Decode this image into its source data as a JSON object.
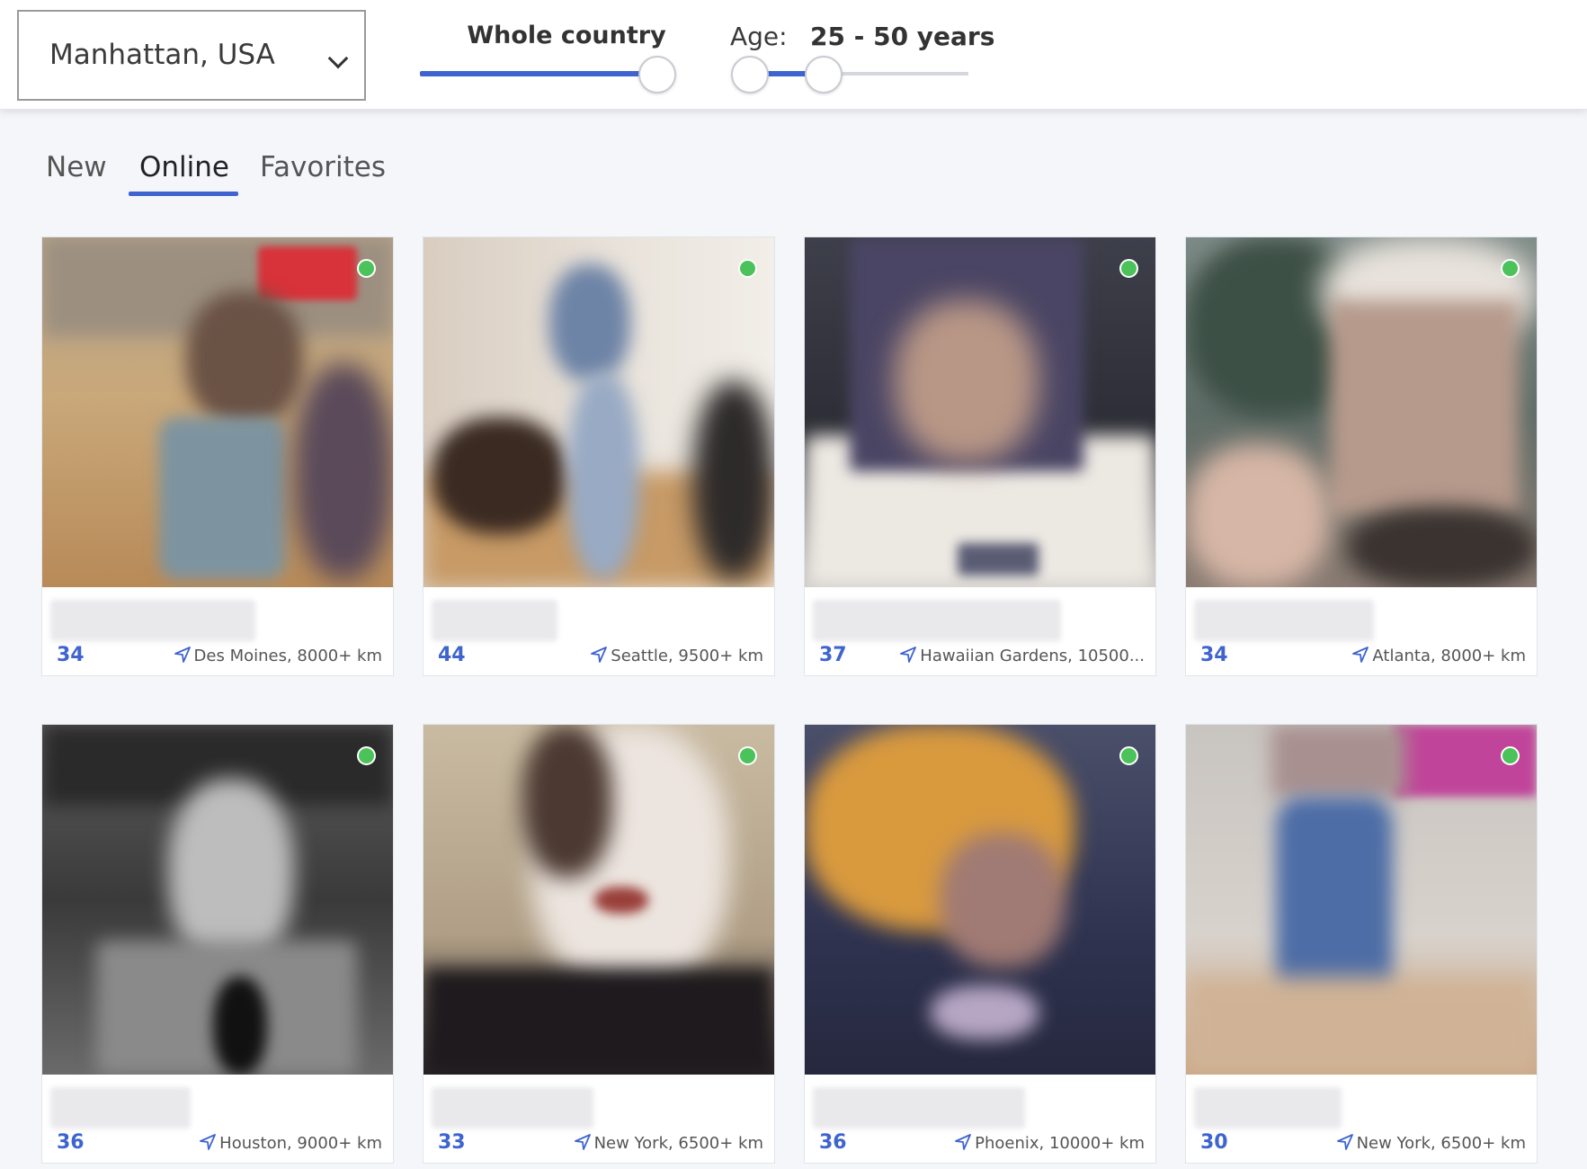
{
  "filters": {
    "location": "Manhattan, USA",
    "distance_label": "Whole country",
    "distance_value": 1.0,
    "age_label": "Age:",
    "age_range_text": "25 - 50 years",
    "age_range": [
      25,
      50
    ],
    "accent_color": "#3e64d0"
  },
  "tabs": [
    {
      "label": "New",
      "active": false
    },
    {
      "label": "Online",
      "active": true
    },
    {
      "label": "Favorites",
      "active": false
    }
  ],
  "profiles": [
    {
      "age": "34",
      "location": "Des Moines, 8000+ km",
      "online": true
    },
    {
      "age": "44",
      "location": "Seattle, 9500+ km",
      "online": true
    },
    {
      "age": "37",
      "location": "Hawaiian Gardens, 10500...",
      "online": true
    },
    {
      "age": "34",
      "location": "Atlanta, 8000+ km",
      "online": true
    },
    {
      "age": "36",
      "location": "Houston, 9000+ km",
      "online": true
    },
    {
      "age": "33",
      "location": "New York, 6500+ km",
      "online": true
    },
    {
      "age": "36",
      "location": "Phoenix, 10000+ km",
      "online": true
    },
    {
      "age": "30",
      "location": "New York, 6500+ km",
      "online": true
    }
  ],
  "icons": {
    "chevron": "chevron-down-icon",
    "location": "location-arrow-icon",
    "online": "online-status-dot"
  }
}
